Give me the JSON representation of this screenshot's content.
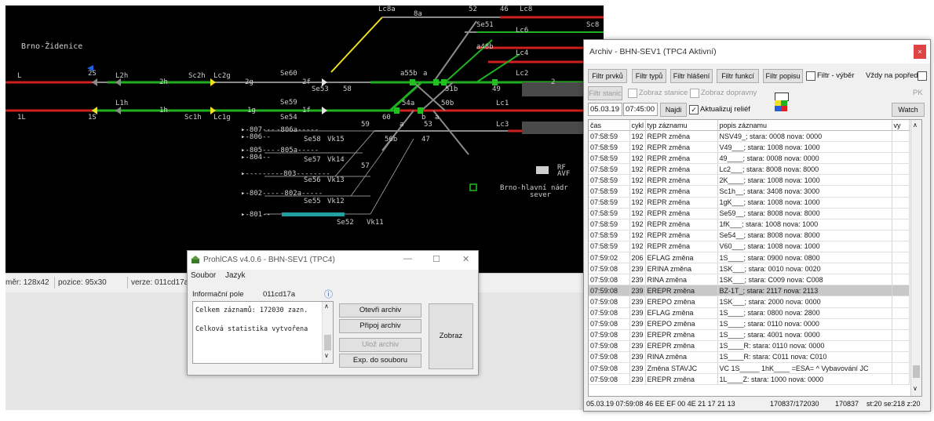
{
  "railway": {
    "station_name": "Brno-Židenice",
    "labels": [
      {
        "id": "lc8a",
        "t": "Lc8a"
      },
      {
        "id": "8a",
        "t": "8a"
      },
      {
        "id": "52",
        "t": "52"
      },
      {
        "id": "46",
        "t": "46"
      },
      {
        "id": "lc8",
        "t": "Lc8"
      },
      {
        "id": "sc8",
        "t": "Sc8"
      },
      {
        "id": "se51",
        "t": "Se51"
      },
      {
        "id": "lc6",
        "t": "Lc6"
      },
      {
        "id": "a48b",
        "t": "a48b"
      },
      {
        "id": "lc4",
        "t": "Lc4"
      },
      {
        "id": "L",
        "t": "L"
      },
      {
        "id": "2S",
        "t": "2S"
      },
      {
        "id": "L2h",
        "t": "L2h"
      },
      {
        "id": "2h",
        "t": "2h"
      },
      {
        "id": "sc2h",
        "t": "Sc2h"
      },
      {
        "id": "lc2g",
        "t": "Lc2g"
      },
      {
        "id": "2g",
        "t": "2g"
      },
      {
        "id": "se60",
        "t": "Se60"
      },
      {
        "id": "2f",
        "t": "2f"
      },
      {
        "id": "se53",
        "t": "Se53"
      },
      {
        "id": "58",
        "t": "58"
      },
      {
        "id": "a55b",
        "t": "a55b"
      },
      {
        "id": "a",
        "t": "a"
      },
      {
        "id": "51b",
        "t": "51b"
      },
      {
        "id": "49",
        "t": "49"
      },
      {
        "id": "lc2",
        "t": "Lc2"
      },
      {
        "id": "2",
        "t": "2"
      },
      {
        "id": "L1h",
        "t": "L1h"
      },
      {
        "id": "1h",
        "t": "1h"
      },
      {
        "id": "sc1h",
        "t": "Sc1h"
      },
      {
        "id": "lc1g",
        "t": "Lc1g"
      },
      {
        "id": "1g",
        "t": "1g"
      },
      {
        "id": "se59",
        "t": "Se59"
      },
      {
        "id": "1f",
        "t": "1f"
      },
      {
        "id": "se54",
        "t": "Se54"
      },
      {
        "id": "60",
        "t": "60"
      },
      {
        "id": "54a",
        "t": "54a"
      },
      {
        "id": "50b",
        "t": "50b"
      },
      {
        "id": "b",
        "t": "b"
      },
      {
        "id": "a2",
        "t": "a"
      },
      {
        "id": "lc1",
        "t": "Lc1"
      },
      {
        "id": "1L",
        "t": "1L"
      },
      {
        "id": "1S",
        "t": "1S"
      },
      {
        "id": "59",
        "t": "59"
      },
      {
        "id": "a3",
        "t": "a"
      },
      {
        "id": "53",
        "t": "53"
      },
      {
        "id": "lc3",
        "t": "Lc3"
      },
      {
        "id": "807",
        "t": "▸-807---"
      },
      {
        "id": "806a",
        "t": "-806a-----"
      },
      {
        "id": "806",
        "t": "▸-806--"
      },
      {
        "id": "se58",
        "t": "Se58"
      },
      {
        "id": "vk15",
        "t": "Vk15"
      },
      {
        "id": "56b",
        "t": "56b"
      },
      {
        "id": "47",
        "t": "47"
      },
      {
        "id": "805",
        "t": "▸-805---"
      },
      {
        "id": "805a",
        "t": "-805a-----"
      },
      {
        "id": "804",
        "t": "▸-804--"
      },
      {
        "id": "se57",
        "t": "Se57"
      },
      {
        "id": "vk14",
        "t": "Vk14"
      },
      {
        "id": "57",
        "t": "57"
      },
      {
        "id": "803",
        "t": "▸---------803--------"
      },
      {
        "id": "se56",
        "t": "Se56"
      },
      {
        "id": "vk13",
        "t": "Vk13"
      },
      {
        "id": "802",
        "t": "▸-802----"
      },
      {
        "id": "802a",
        "t": "-802a-----"
      },
      {
        "id": "se55",
        "t": "Se55"
      },
      {
        "id": "vk12",
        "t": "Vk12"
      },
      {
        "id": "801",
        "t": "▸-801--"
      },
      {
        "id": "se52",
        "t": "Se52"
      },
      {
        "id": "vk11",
        "t": "Vk11"
      },
      {
        "id": "rf",
        "t": "RF"
      },
      {
        "id": "avf",
        "t": "AVF"
      },
      {
        "id": "brnohl",
        "t": "Brno-hlavní  nádr"
      },
      {
        "id": "sever",
        "t": "sever"
      }
    ]
  },
  "statusbar": {
    "cells": [
      "měr: 128x42",
      "pozice: 95x30",
      "verze: 011cd17a."
    ]
  },
  "prohlcas": {
    "title": "ProhlCAS v4.0.6 - BHN-SEV1 (TPC4)",
    "menu": [
      "Soubor",
      "Jazyk"
    ],
    "info_label": "Informační pole",
    "info_value": "011cd17a",
    "info_lines": [
      "Celkem záznamů: 172030 zazn.",
      "Celková statistika vytvořena"
    ],
    "buttons": {
      "open": "Otevři archiv",
      "attach": "Připoj archiv",
      "save": "Ulož archiv",
      "export": "Exp. do souboru",
      "show": "Zobraz"
    },
    "window_controls": [
      "—",
      "☐",
      "✕"
    ]
  },
  "archiv": {
    "title": "Archiv - BHN-SEV1 (TPC4 Aktivní)",
    "close_label": "×",
    "filter_buttons": [
      "Filtr prvků",
      "Filtr typů",
      "Filtr hlášení",
      "Filtr funkcí",
      "Filtr popisu"
    ],
    "filtr_vyber": "Filtr - výběr",
    "vzdy_na_popredi": "Vždy na popředí",
    "filtr_stanic": "Filtr stanic",
    "zobraz_stanice": "Zobraz stanice",
    "zobraz_dopravny": "Zobraz dopravny",
    "pk": "PK",
    "date": "05.03.19",
    "time": "07:45:00",
    "najdi": "Najdi",
    "aktualizuj": "Aktualizuj reliéf",
    "watch": "Watch",
    "columns": [
      "čas",
      "cykl",
      "typ záznamu",
      "popis záznamu",
      "vy"
    ],
    "rows": [
      [
        "07:58:59",
        "192",
        "REPR změna",
        "NSV49_; stara: 0008 nova: 0000"
      ],
      [
        "07:58:59",
        "192",
        "REPR změna",
        "V49___; stara: 1008 nova: 1000"
      ],
      [
        "07:58:59",
        "192",
        "REPR změna",
        "49____; stara: 0008 nova: 0000"
      ],
      [
        "07:58:59",
        "192",
        "REPR změna",
        "Lc2___; stara: 8008 nova: 8000"
      ],
      [
        "07:58:59",
        "192",
        "REPR změna",
        "2K____; stara: 1008 nova: 1000"
      ],
      [
        "07:58:59",
        "192",
        "REPR změna",
        "Sc1h__; stara: 3408 nova: 3000"
      ],
      [
        "07:58:59",
        "192",
        "REPR změna",
        "1gK___; stara: 1008 nova: 1000"
      ],
      [
        "07:58:59",
        "192",
        "REPR změna",
        "Se59__; stara: 8008 nova: 8000"
      ],
      [
        "07:58:59",
        "192",
        "REPR změna",
        "1fK___; stara: 1008 nova: 1000"
      ],
      [
        "07:58:59",
        "192",
        "REPR změna",
        "Se54__; stara: 8008 nova: 8000"
      ],
      [
        "07:58:59",
        "192",
        "REPR změna",
        "V60___; stara: 1008 nova: 1000"
      ],
      [
        "07:59:02",
        "206",
        "EFLAG změna",
        "1S____; stara: 0900 nova: 0800"
      ],
      [
        "07:59:08",
        "239",
        "ERINA změna",
        "1SK___; stara: 0010 nova: 0020"
      ],
      [
        "07:59:08",
        "239",
        "RINA změna",
        "1SK___; stara: C009 nova: C008"
      ],
      [
        "07:59:08",
        "239",
        "EREPR změna",
        "BZ-1T_; stara: 2117 nova: 2113"
      ],
      [
        "07:59:08",
        "239",
        "EREPO změna",
        "1SK___; stara: 2000 nova: 0000"
      ],
      [
        "07:59:08",
        "239",
        "EFLAG změna",
        "1S____; stara: 0800 nova: 2800"
      ],
      [
        "07:59:08",
        "239",
        "EREPO změna",
        "1S____; stara: 0110 nova: 0000"
      ],
      [
        "07:59:08",
        "239",
        "EREPR změna",
        "1S____; stara: 4001 nova: 0000"
      ],
      [
        "07:59:08",
        "239",
        "EREPR změna",
        "1S____R: stara: 0110 nova: 0000"
      ],
      [
        "07:59:08",
        "239",
        "RINA změna",
        "1S____R: stara: C011 nova: C010"
      ],
      [
        "07:59:08",
        "239",
        "Změna STAVJC",
        "VC  1S_____  1hK____  =ESA= ^ Vybavování JC"
      ],
      [
        "07:59:08",
        "239",
        "EREPR změna",
        "1L____Z: stara: 1000 nova: 0000"
      ]
    ],
    "selected_row": 14,
    "status": [
      "05.03.19  07:59:08  46  EE EF 00 4E 21 17 21 13",
      "170837/172030",
      "170837",
      "st:20 se:218 z:20"
    ],
    "colors": {
      "red": "#e02020",
      "green": "#20b020",
      "yellow": "#f0e020",
      "blue": "#2060e0"
    }
  }
}
